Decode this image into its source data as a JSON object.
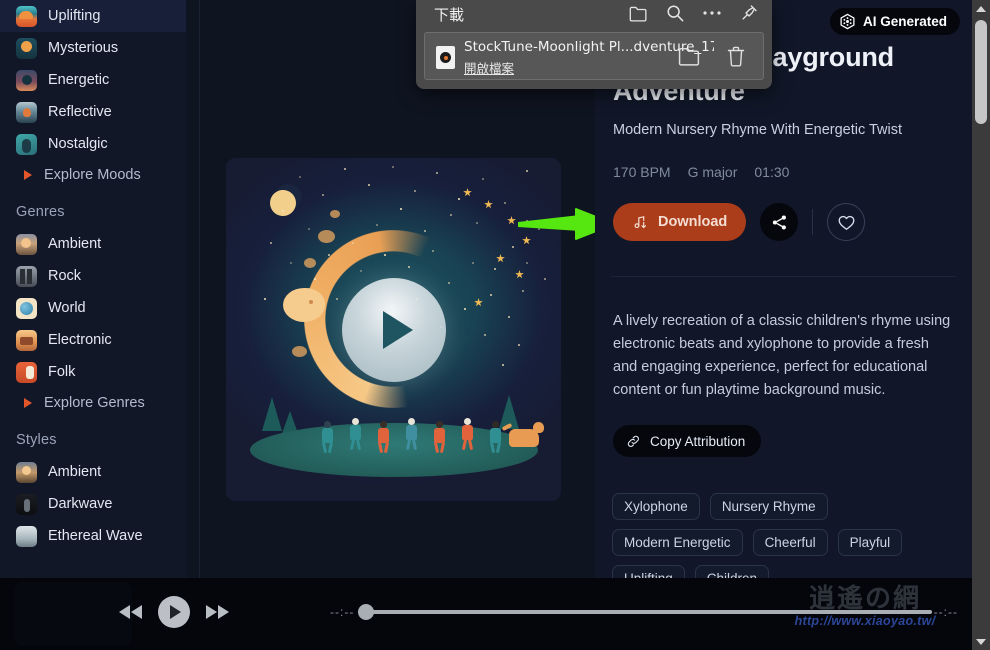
{
  "sidebar": {
    "moods": [
      {
        "label": "Uplifting",
        "thumb": "t-uplift"
      },
      {
        "label": "Mysterious",
        "thumb": "t-mystery"
      },
      {
        "label": "Energetic",
        "thumb": "t-energet"
      },
      {
        "label": "Reflective",
        "thumb": "t-reflect"
      },
      {
        "label": "Nostalgic",
        "thumb": "t-nostal"
      }
    ],
    "explore_moods": "Explore Moods",
    "genres_title": "Genres",
    "genres": [
      {
        "label": "Ambient",
        "thumb": "t-ambient"
      },
      {
        "label": "Rock",
        "thumb": "t-rock"
      },
      {
        "label": "World",
        "thumb": "t-world"
      },
      {
        "label": "Electronic",
        "thumb": "t-electro"
      },
      {
        "label": "Folk",
        "thumb": "t-folk"
      }
    ],
    "explore_genres": "Explore Genres",
    "styles_title": "Styles",
    "styles": [
      {
        "label": "Ambient",
        "thumb": "t-sambient"
      },
      {
        "label": "Darkwave",
        "thumb": "t-dark"
      },
      {
        "label": "Ethereal Wave",
        "thumb": "t-ethereal"
      }
    ]
  },
  "download_popup": {
    "title": "下載",
    "filename": "StockTune-Moonlight Pl...dventure_17",
    "open_file_link": "開啟檔案",
    "icons": {
      "folder": "folder-icon",
      "search": "search-icon",
      "more": "more-icon",
      "pin": "pin-icon",
      "item_folder": "open-folder-icon",
      "item_delete": "trash-icon"
    }
  },
  "detail": {
    "ai_badge": "AI Generated",
    "title": "Moonlight Playground Adventure",
    "subtitle": "Modern Nursery Rhyme With Energetic Twist",
    "meta": {
      "bpm": "170 BPM",
      "key": "G major",
      "duration": "01:30"
    },
    "download_label": "Download",
    "copy_attribution_label": "Copy Attribution",
    "description": "A lively recreation of a classic children's rhyme using electronic beats and xylophone to provide a fresh and engaging experience, perfect for educational content or fun playtime background music.",
    "tags": [
      "Xylophone",
      "Nursery Rhyme",
      "Modern Energetic",
      "Cheerful",
      "Playful",
      "Uplifting",
      "Children"
    ],
    "accent_color": "#ab3d1a",
    "badge_color": "#05070d"
  },
  "player": {
    "time_current": "--:--",
    "time_total": "--:--",
    "progress_percent": 0
  },
  "watermark": {
    "text_cn": "逍遙の網",
    "url": "http://www.xiaoyao.tw/"
  },
  "annotation": {
    "arrow_color": "#56e610",
    "arrow_target": "download-button"
  }
}
